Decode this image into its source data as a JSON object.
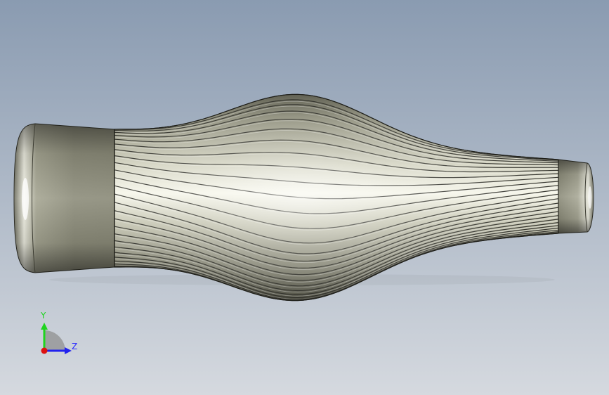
{
  "viewport": {
    "background_top": "#8a9bb1",
    "background_bottom": "#d5d9df"
  },
  "model": {
    "name": "fluted-handle",
    "groove_count": 26,
    "body_color": "#a9a996",
    "highlight_color": "#f6f6ea",
    "shadow_color": "#4d4d40",
    "groove_color": "#262620"
  },
  "triad": {
    "y_label": "Y",
    "z_label": "Z",
    "y_color": "#1fd41f",
    "z_color": "#2222ee",
    "x_color": "#dd1111"
  }
}
